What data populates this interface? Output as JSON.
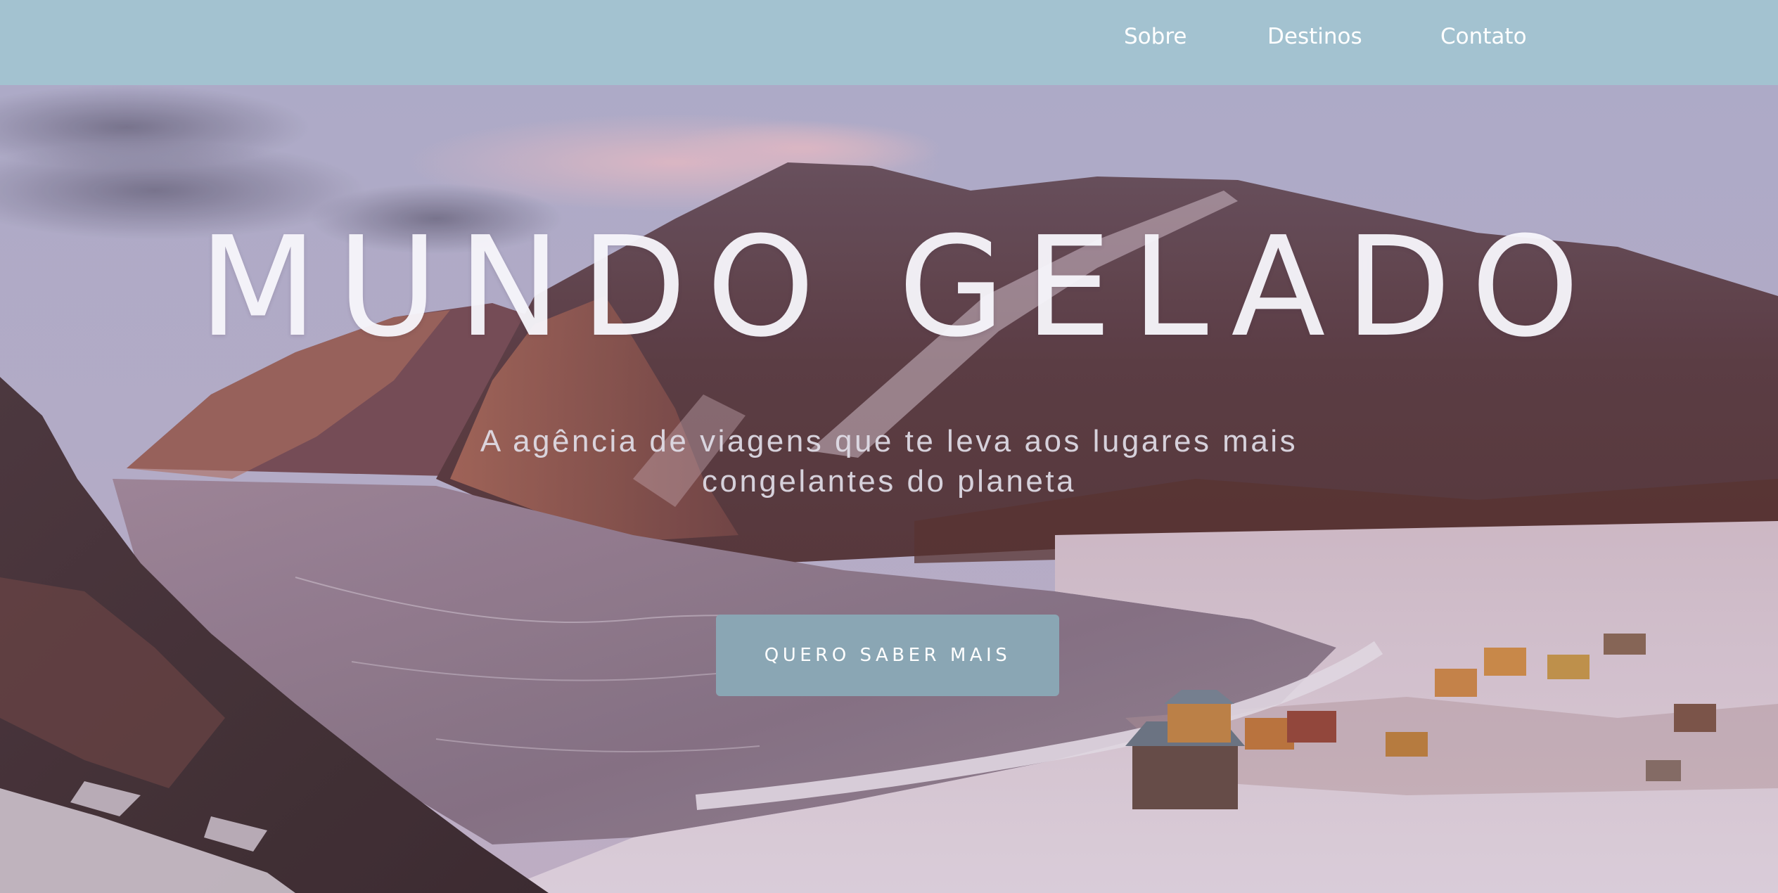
{
  "nav": {
    "items": [
      {
        "label": "Sobre"
      },
      {
        "label": "Destinos"
      },
      {
        "label": "Contato"
      }
    ]
  },
  "hero": {
    "title": "MUNDO GELADO",
    "subtitle": "A agência de viagens que te leva aos lugares mais congelantes do planeta",
    "cta_label": "QUERO SABER MAIS",
    "background_image": "snowy-mountain-lake-landscape"
  },
  "colors": {
    "navbar": "#a3c2d0",
    "nav_text": "#ffffff",
    "button": "#8aa6b4",
    "title_text": "#f8f7fc"
  }
}
